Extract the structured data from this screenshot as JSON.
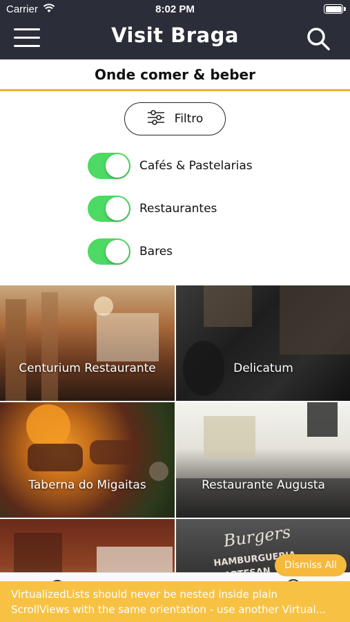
{
  "status": {
    "carrier": "Carrier",
    "time": "8:02 PM"
  },
  "header": {
    "brand": "Visit Braga",
    "menu_icon": "menu-icon",
    "search_icon": "search-icon"
  },
  "page": {
    "title": "Onde comer & beber"
  },
  "filter": {
    "label": "Filtro",
    "icon": "sliders-icon"
  },
  "toggles": [
    {
      "label": "Cafés & Pastelarias",
      "on": true
    },
    {
      "label": "Restaurantes",
      "on": true
    },
    {
      "label": "Bares",
      "on": true
    }
  ],
  "places": [
    {
      "name": "Centurium Restaurante"
    },
    {
      "name": "Delicatum"
    },
    {
      "name": "Taberna do Migaitas"
    },
    {
      "name": "Restaurante Augusta"
    },
    {
      "name": ""
    },
    {
      "name": ""
    }
  ],
  "tile6_overlay": {
    "line1": "Burgers",
    "line2": "HAMBURGUERIA",
    "line3": "ARTESAN"
  },
  "warning": {
    "line1": "VirtualizedLists should never be nested inside plain",
    "line2": "ScrollViews with the same orientation - use another Virtual...",
    "dismiss": "Dismiss All"
  },
  "colors": {
    "header_bg": "#2b2e38",
    "accent": "#f0b429",
    "toggle_on": "#4cd964",
    "warning_bg": "#f7c244"
  }
}
